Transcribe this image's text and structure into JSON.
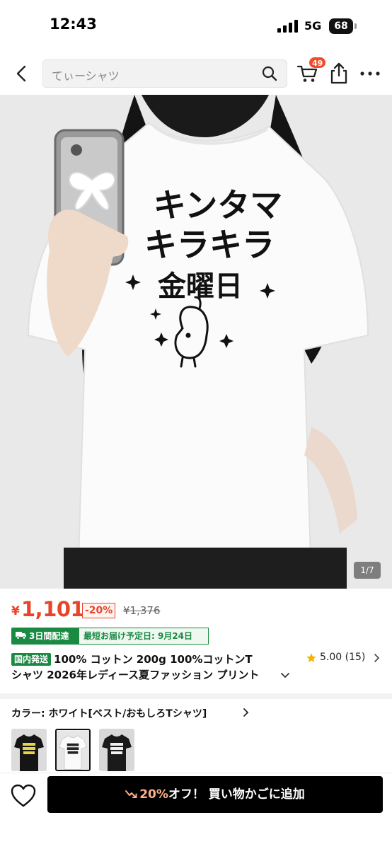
{
  "status_bar": {
    "time": "12:43",
    "network": "5G",
    "battery": "68"
  },
  "header": {
    "search_placeholder": "てぃーシャツ",
    "cart_count": "49"
  },
  "gallery": {
    "counter": "1/7",
    "shirt_print_lines": [
      "キンタマ",
      "キラキラ",
      "金曜日"
    ]
  },
  "price": {
    "currency": "¥",
    "amount": "1,101",
    "discount": "-20%",
    "original": "¥1,376"
  },
  "shipping": {
    "badge": "3日間配達",
    "estimate": "最短お届け予定日: 9月24日"
  },
  "product": {
    "domestic_badge": "国内発送",
    "title_line1": "100% コットン 200g 100%コットンT",
    "title_line2": "シャツ 2026年レディース夏ファッション プリント",
    "rating": "5.00 (15)"
  },
  "variant": {
    "color_label": "カラー: ホワイト[ベスト/おもしろTシャツ]"
  },
  "bottom_bar": {
    "add_to_cart_pct": "20%",
    "add_to_cart_rest": "オフ！ 買い物かごに追加"
  },
  "colors": {
    "accent_red": "#e8442a",
    "ship_green": "#1a8a43",
    "cta_black": "#000000"
  }
}
